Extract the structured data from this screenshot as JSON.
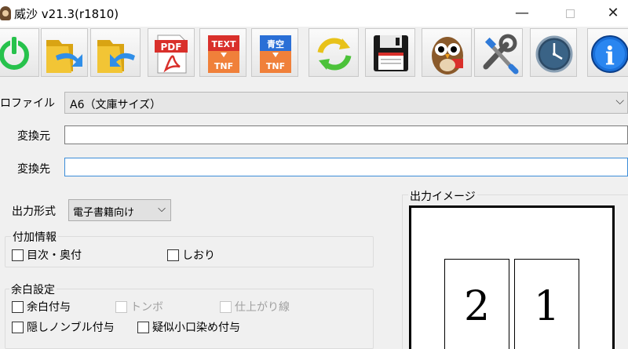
{
  "window": {
    "title": "威沙 v21.3(r1810)",
    "minimize_glyph": "—",
    "close_glyph": "✕"
  },
  "toolbar": {
    "buttons": [
      {
        "name": "power-button",
        "icon": "power-icon"
      },
      {
        "name": "open-folder-button",
        "icon": "folder-forward-icon"
      },
      {
        "name": "folder-back-button",
        "icon": "folder-back-icon"
      },
      {
        "name": "pdf-button",
        "icon": "pdf-icon",
        "label": "PDF"
      },
      {
        "name": "text-tnf-button",
        "icon": "text-tnf-icon",
        "label_top": "TEXT",
        "label_bottom": "TNF"
      },
      {
        "name": "aozora-tnf-button",
        "icon": "aozora-tnf-icon",
        "label_top": "青空",
        "label_bottom": "TNF"
      },
      {
        "name": "refresh-button",
        "icon": "refresh-icon"
      },
      {
        "name": "save-button",
        "icon": "floppy-disk-icon"
      },
      {
        "name": "owl-button",
        "icon": "owl-icon"
      },
      {
        "name": "tools-button",
        "icon": "tools-icon"
      },
      {
        "name": "clock-button",
        "icon": "clock-icon"
      },
      {
        "name": "info-button",
        "icon": "info-icon",
        "label": "i"
      }
    ]
  },
  "form": {
    "profile_label": "ロファイル",
    "profile_value": "A6（文庫サイズ）",
    "source_label": "変換元",
    "source_value": "",
    "dest_label": "変換先",
    "dest_value": "",
    "output_format_label": "出力形式",
    "output_format_value": "電子書籍向け"
  },
  "additional_info": {
    "title": "付加情報",
    "toc": "目次・奥付",
    "bookmark": "しおり"
  },
  "margin_settings": {
    "title": "余白設定",
    "add_margin": "余白付与",
    "tombo": "トンボ",
    "finish_line": "仕上がり線",
    "hidden_nombre": "隠しノンブル付与",
    "fore_edge_dye": "疑似小口染め付与"
  },
  "preview": {
    "title": "出力イメージ",
    "left_page": "2",
    "right_page": "1"
  },
  "colors": {
    "power_green": "#27c24c",
    "folder_yellow": "#e8b820",
    "pdf_red": "#d9302b",
    "tnf_orange": "#f0803a",
    "aozora_blue": "#2a6fd6",
    "focus_blue": "#3c8dd8",
    "info_blue": "#1a6fd8"
  }
}
